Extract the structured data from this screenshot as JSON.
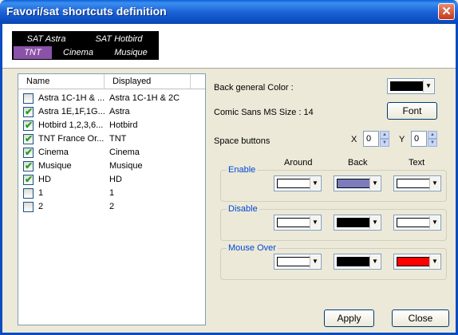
{
  "window": {
    "title": "Favori/sat shortcuts definition",
    "close_glyph": "✕"
  },
  "tabs": [
    {
      "label": "SAT Astra",
      "active": false
    },
    {
      "label": "SAT Hotbird",
      "active": false
    },
    {
      "label": "TNT",
      "active": true
    },
    {
      "label": "Cinema",
      "active": false
    },
    {
      "label": "Musique",
      "active": false
    }
  ],
  "list": {
    "headers": {
      "name": "Name",
      "displayed": "Displayed"
    },
    "rows": [
      {
        "name": "Astra 1C-1H & ...",
        "displayed": "Astra 1C-1H & 2C",
        "checked": false
      },
      {
        "name": "Astra 1E,1F,1G...",
        "displayed": "Astra",
        "checked": true
      },
      {
        "name": "Hotbird 1,2,3,6...",
        "displayed": "Hotbird",
        "checked": true
      },
      {
        "name": "TNT France Or...",
        "displayed": "TNT",
        "checked": true
      },
      {
        "name": "Cinema",
        "displayed": "Cinema",
        "checked": true
      },
      {
        "name": "Musique",
        "displayed": "Musique",
        "checked": true
      },
      {
        "name": "HD",
        "displayed": "HD",
        "checked": true
      },
      {
        "name": "1",
        "displayed": "1",
        "checked": false
      },
      {
        "name": "2",
        "displayed": "2",
        "checked": false
      }
    ]
  },
  "settings": {
    "back_general_color_label": "Back general Color :",
    "back_general_color": "#000000",
    "font_info": "Comic Sans MS  Size : 14",
    "font_button": "Font",
    "space_buttons_label": "Space buttons",
    "x_label": "X",
    "x_value": "0",
    "y_label": "Y",
    "y_value": "0"
  },
  "columns": {
    "around": "Around",
    "back": "Back",
    "text": "Text"
  },
  "groups": {
    "enable": {
      "label": "Enable",
      "around": "#ffffff",
      "back": "#7b7bbd",
      "text": "#ffffff"
    },
    "disable": {
      "label": "Disable",
      "around": "#ffffff",
      "back": "#000000",
      "text": "#ffffff"
    },
    "mouse_over": {
      "label": "Mouse Over",
      "around": "#ffffff",
      "back": "#000000",
      "text": "#ff0000"
    }
  },
  "buttons": {
    "apply": "Apply",
    "close": "Close"
  },
  "icons": {
    "check": "✔",
    "dropdown": "▼",
    "spin_up": "▲",
    "spin_down": "▼"
  }
}
